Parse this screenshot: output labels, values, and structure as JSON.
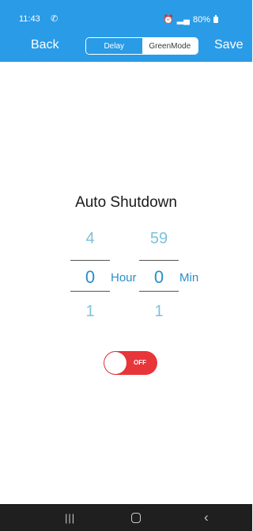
{
  "status": {
    "time": "11:43",
    "phone_icon": "phone-wifi-call-icon",
    "right_text": "80%"
  },
  "header": {
    "back_label": "Back",
    "save_label": "Save",
    "tabs": [
      {
        "label": "Delay",
        "selected": false
      },
      {
        "label": "GreenMode",
        "selected": true
      }
    ],
    "accent": "#2a9be6"
  },
  "main": {
    "title": "Auto Shutdown",
    "hour": {
      "prev": "4",
      "current": "0",
      "next": "1",
      "unit": "Hour"
    },
    "minute": {
      "prev": "59",
      "current": "0",
      "next": "1",
      "unit": "Min"
    },
    "toggle": {
      "label": "OFF",
      "state": "off",
      "color": "#e8353a"
    }
  },
  "navbar": {
    "recent": "|||",
    "back": "‹"
  }
}
